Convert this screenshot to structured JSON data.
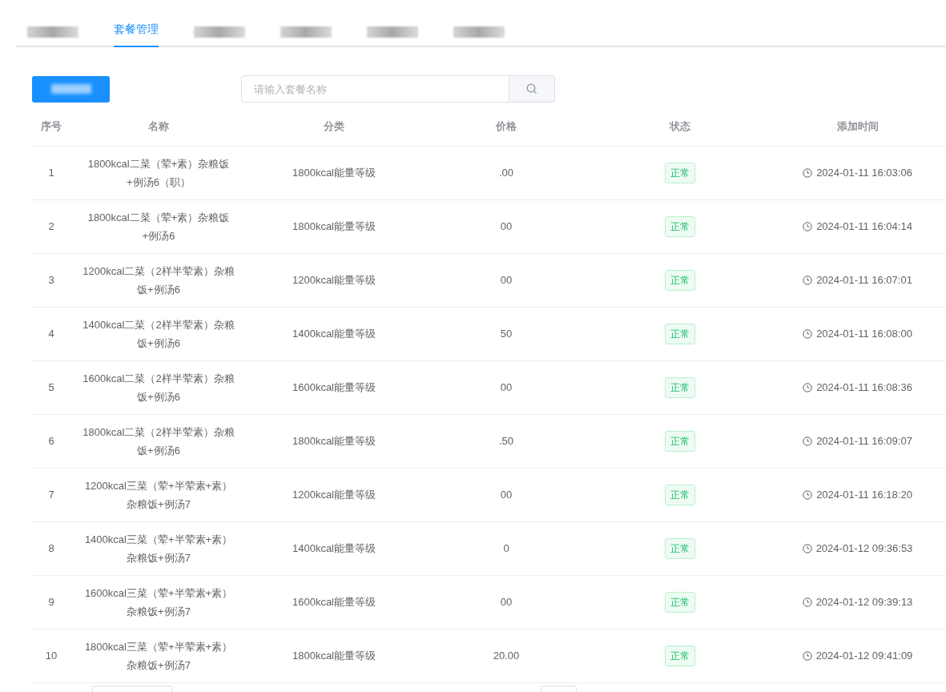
{
  "tabs": [
    {
      "redacted": true,
      "selected": false
    },
    {
      "label": "套餐管理",
      "selected": true
    },
    {
      "redacted": true,
      "selected": false
    },
    {
      "redacted": true,
      "selected": false
    },
    {
      "redacted": true,
      "selected": false
    },
    {
      "redacted": true,
      "selected": false
    }
  ],
  "add_button": {
    "redacted": true
  },
  "search": {
    "placeholder": "请输入套餐名称"
  },
  "table": {
    "columns": [
      "序号",
      "名称",
      "分类",
      "价格",
      "状态",
      "添加时间"
    ],
    "rows": [
      {
        "index": "1",
        "name": "1800kcal二菜（荤+素）杂粮饭+例汤6（职）",
        "category": "1800kcal能量等级",
        "price": ".00",
        "status": "正常",
        "time": "2024-01-11 16:03:06"
      },
      {
        "index": "2",
        "name": "1800kcal二菜（荤+素）杂粮饭+例汤6",
        "category": "1800kcal能量等级",
        "price": "00",
        "status": "正常",
        "time": "2024-01-11 16:04:14"
      },
      {
        "index": "3",
        "name": "1200kcal二菜（2样半荤素）杂粮饭+例汤6",
        "category": "1200kcal能量等级",
        "price": "00",
        "status": "正常",
        "time": "2024-01-11 16:07:01"
      },
      {
        "index": "4",
        "name": "1400kcal二菜（2样半荤素）杂粮饭+例汤6",
        "category": "1400kcal能量等级",
        "price": "50",
        "status": "正常",
        "time": "2024-01-11 16:08:00"
      },
      {
        "index": "5",
        "name": "1600kcal二菜（2样半荤素）杂粮饭+例汤6",
        "category": "1600kcal能量等级",
        "price": "00",
        "status": "正常",
        "time": "2024-01-11 16:08:36"
      },
      {
        "index": "6",
        "name": "1800kcal二菜（2样半荤素）杂粮饭+例汤6",
        "category": "1800kcal能量等级",
        "price": ".50",
        "status": "正常",
        "time": "2024-01-11 16:09:07"
      },
      {
        "index": "7",
        "name": "1200kcal三菜（荤+半荤素+素）杂粮饭+例汤7",
        "category": "1200kcal能量等级",
        "price": "00",
        "status": "正常",
        "time": "2024-01-11 16:18:20"
      },
      {
        "index": "8",
        "name": "1400kcal三菜（荤+半荤素+素）杂粮饭+例汤7",
        "category": "1400kcal能量等级",
        "price": "0",
        "status": "正常",
        "time": "2024-01-12 09:36:53"
      },
      {
        "index": "9",
        "name": "1600kcal三菜（荤+半荤素+素）杂粮饭+例汤7",
        "category": "1600kcal能量等级",
        "price": "00",
        "status": "正常",
        "time": "2024-01-12 09:39:13"
      },
      {
        "index": "10",
        "name": "1800kcal三菜（荤+半荤素+素）杂粮饭+例汤7",
        "category": "1800kcal能量等级",
        "price": "20.00",
        "status": "正常",
        "time": "2024-01-12 09:41:09"
      }
    ]
  }
}
